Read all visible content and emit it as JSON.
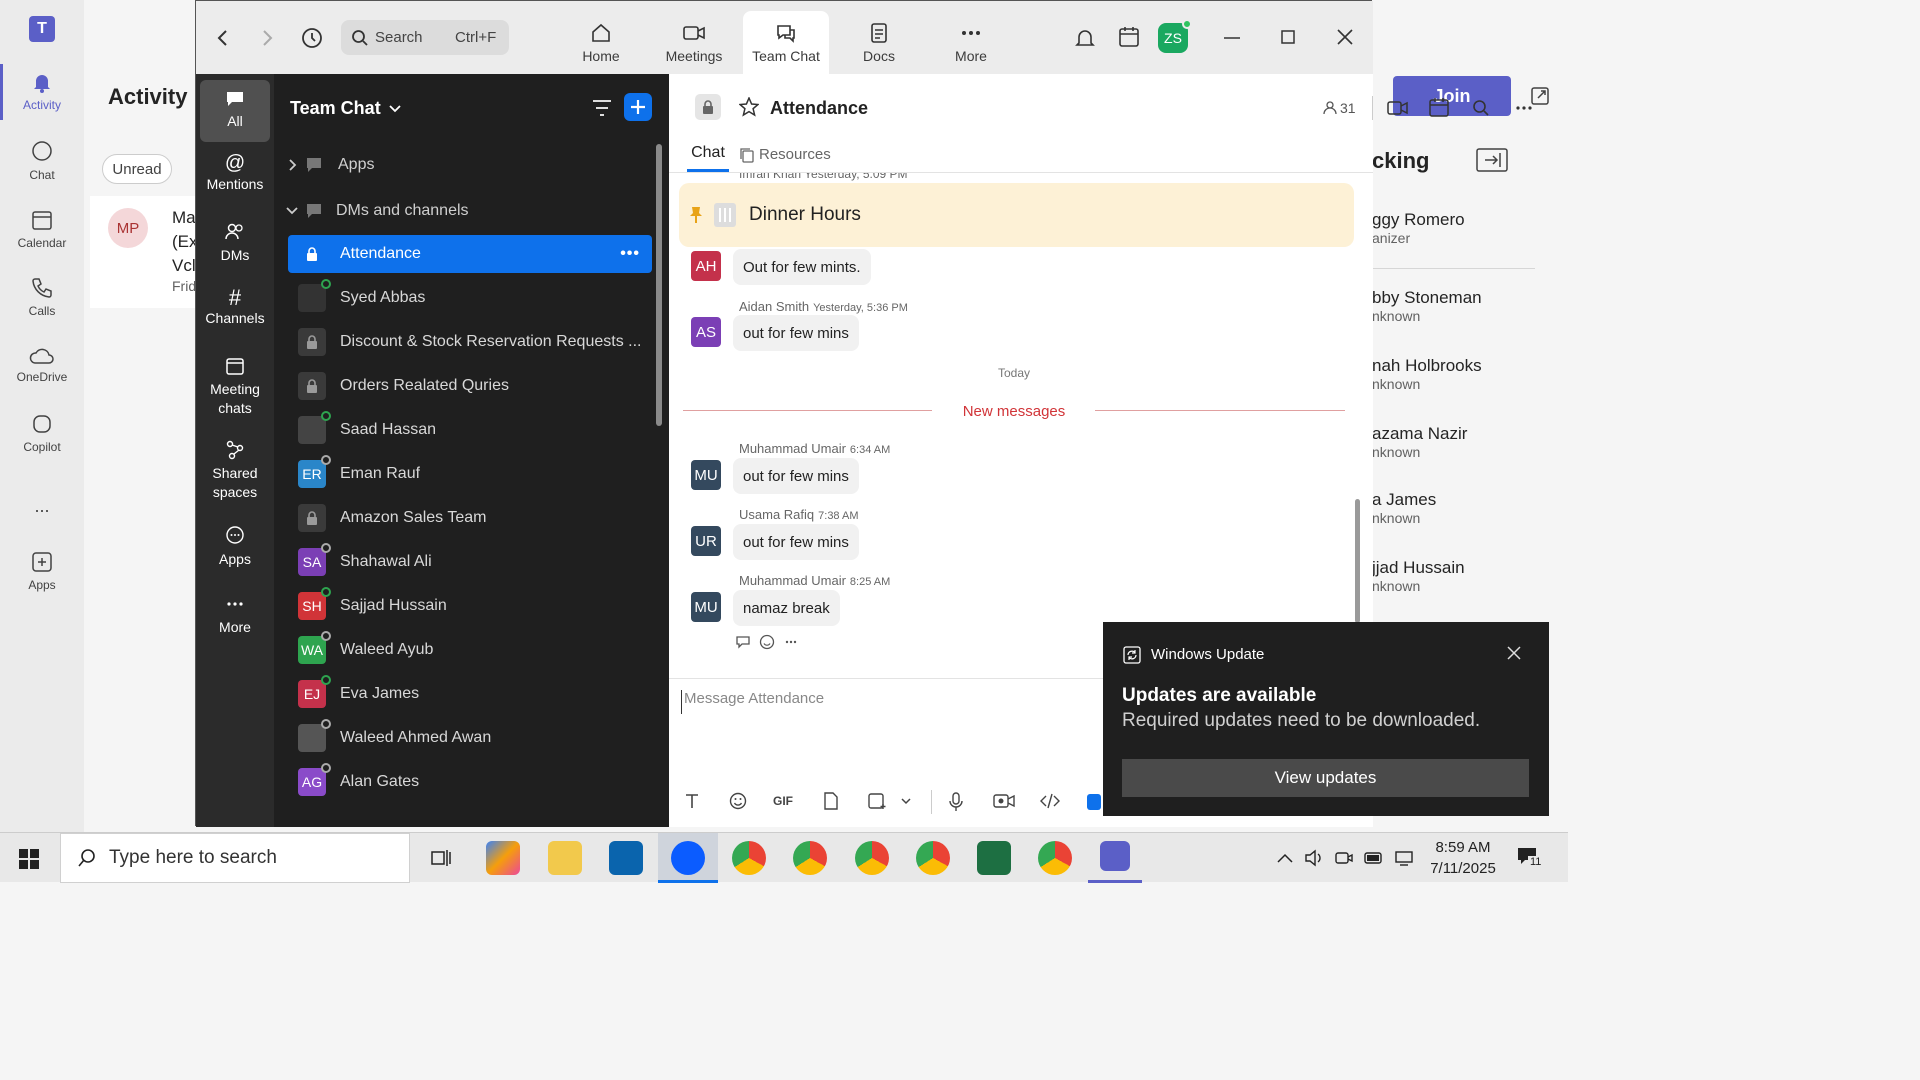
{
  "teams": {
    "rail": [
      {
        "label": "Activity",
        "icon": "bell-icon"
      },
      {
        "label": "Chat",
        "icon": "chat-icon"
      },
      {
        "label": "Calendar",
        "icon": "calendar-icon"
      },
      {
        "label": "Calls",
        "icon": "phone-icon"
      },
      {
        "label": "OneDrive",
        "icon": "cloud-icon"
      },
      {
        "label": "Copilot",
        "icon": "copilot-icon"
      },
      {
        "label": "...",
        "icon": "more-icon"
      },
      {
        "label": "Apps",
        "icon": "plus-box-icon"
      }
    ],
    "activity_title": "Activity",
    "filter_unread": "Unread",
    "activity_item": {
      "initials": "MP",
      "line1": "Ma",
      "line2": "(Ex",
      "line3": "Vcl",
      "line4": "Frid"
    },
    "join_label": "Join",
    "tracking_title": "cking",
    "people": [
      {
        "name": "ggy Romero",
        "role": "anizer"
      },
      {
        "name": "bby Stoneman",
        "role": "nknown"
      },
      {
        "name": "nah Holbrooks",
        "role": "nknown"
      },
      {
        "name": "azama Nazir",
        "role": "nknown"
      },
      {
        "name": "a James",
        "role": "nknown"
      },
      {
        "name": "jjad Hussain",
        "role": "nknown"
      }
    ]
  },
  "zoom": {
    "search_placeholder": "Search",
    "search_shortcut": "Ctrl+F",
    "top_nav": [
      {
        "label": "Home",
        "icon": "home-icon"
      },
      {
        "label": "Meetings",
        "icon": "video-icon"
      },
      {
        "label": "Team Chat",
        "icon": "chat-icon"
      },
      {
        "label": "Docs",
        "icon": "doc-icon"
      },
      {
        "label": "More",
        "icon": "more-icon"
      }
    ],
    "user_initials": "ZS",
    "left_nav": [
      {
        "label": "All"
      },
      {
        "label": "Mentions"
      },
      {
        "label": "DMs"
      },
      {
        "label": "Channels"
      },
      {
        "label": "Meeting chats"
      },
      {
        "label": "Shared spaces"
      },
      {
        "label": "Apps"
      },
      {
        "label": "More"
      }
    ],
    "list_title": "Team Chat",
    "section_apps": "Apps",
    "section_dms": "DMs and channels",
    "chats": [
      {
        "name": "Attendance",
        "type": "lock",
        "active": true
      },
      {
        "name": "Syed Abbas",
        "type": "photo",
        "initials": "",
        "color": "#333",
        "status": "online"
      },
      {
        "name": "Discount & Stock Reservation Requests ...",
        "type": "lock"
      },
      {
        "name": "Orders Realated Quries",
        "type": "lock"
      },
      {
        "name": "Saad Hassan",
        "type": "photo",
        "initials": "",
        "color": "#444",
        "status": "online"
      },
      {
        "name": "Eman Rauf",
        "type": "initials",
        "initials": "ER",
        "color": "#2a86c9",
        "status": "away"
      },
      {
        "name": "Amazon Sales Team",
        "type": "lock"
      },
      {
        "name": "Shahawal Ali",
        "type": "initials",
        "initials": "SA",
        "color": "#7b3fb5",
        "status": "away"
      },
      {
        "name": "Sajjad Hussain",
        "type": "initials",
        "initials": "SH",
        "color": "#d13438",
        "status": "online"
      },
      {
        "name": "Waleed Ayub",
        "type": "initials",
        "initials": "WA",
        "color": "#2ea44f",
        "status": "away"
      },
      {
        "name": "Eva James",
        "type": "initials",
        "initials": "EJ",
        "color": "#c4314b",
        "status": "online"
      },
      {
        "name": "Waleed Ahmed Awan",
        "type": "photo",
        "initials": "",
        "color": "#555",
        "status": "away"
      },
      {
        "name": "Alan Gates",
        "type": "initials",
        "initials": "AG",
        "color": "#8a4bc9",
        "status": "away"
      }
    ],
    "channel": {
      "title": "Attendance",
      "members": "31",
      "tab_chat": "Chat",
      "tab_resources": "Resources",
      "partial_header": "Imran Khan Yesterday, 5:09 PM",
      "pinned": "Dinner Hours",
      "today_label": "Today",
      "new_messages": "New messages",
      "composer_placeholder": "Message Attendance",
      "messages": [
        {
          "initials": "AH",
          "color": "#c4314b",
          "sender": "",
          "time": "",
          "text": "Out for few mints."
        },
        {
          "initials": "AS",
          "color": "#7b3fb5",
          "sender": "Aidan Smith",
          "time": "Yesterday, 5:36 PM",
          "text": "out for few mins"
        },
        {
          "initials": "MU",
          "color": "#34495e",
          "sender": "Muhammad Umair",
          "time": "6:34 AM",
          "text": "out for few mins"
        },
        {
          "initials": "UR",
          "color": "#34495e",
          "sender": "Usama Rafiq",
          "time": "7:38 AM",
          "text": "out for few mins"
        },
        {
          "initials": "MU",
          "color": "#34495e",
          "sender": "Muhammad Umair",
          "time": "8:25 AM",
          "text": "namaz break"
        }
      ]
    }
  },
  "toast": {
    "app": "Windows Update",
    "title": "Updates are available",
    "body": "Required updates need to be downloaded.",
    "button": "View updates"
  },
  "taskbar": {
    "search_placeholder": "Type here to search",
    "time": "8:59 AM",
    "date": "7/11/2025",
    "notif_count": "11"
  }
}
